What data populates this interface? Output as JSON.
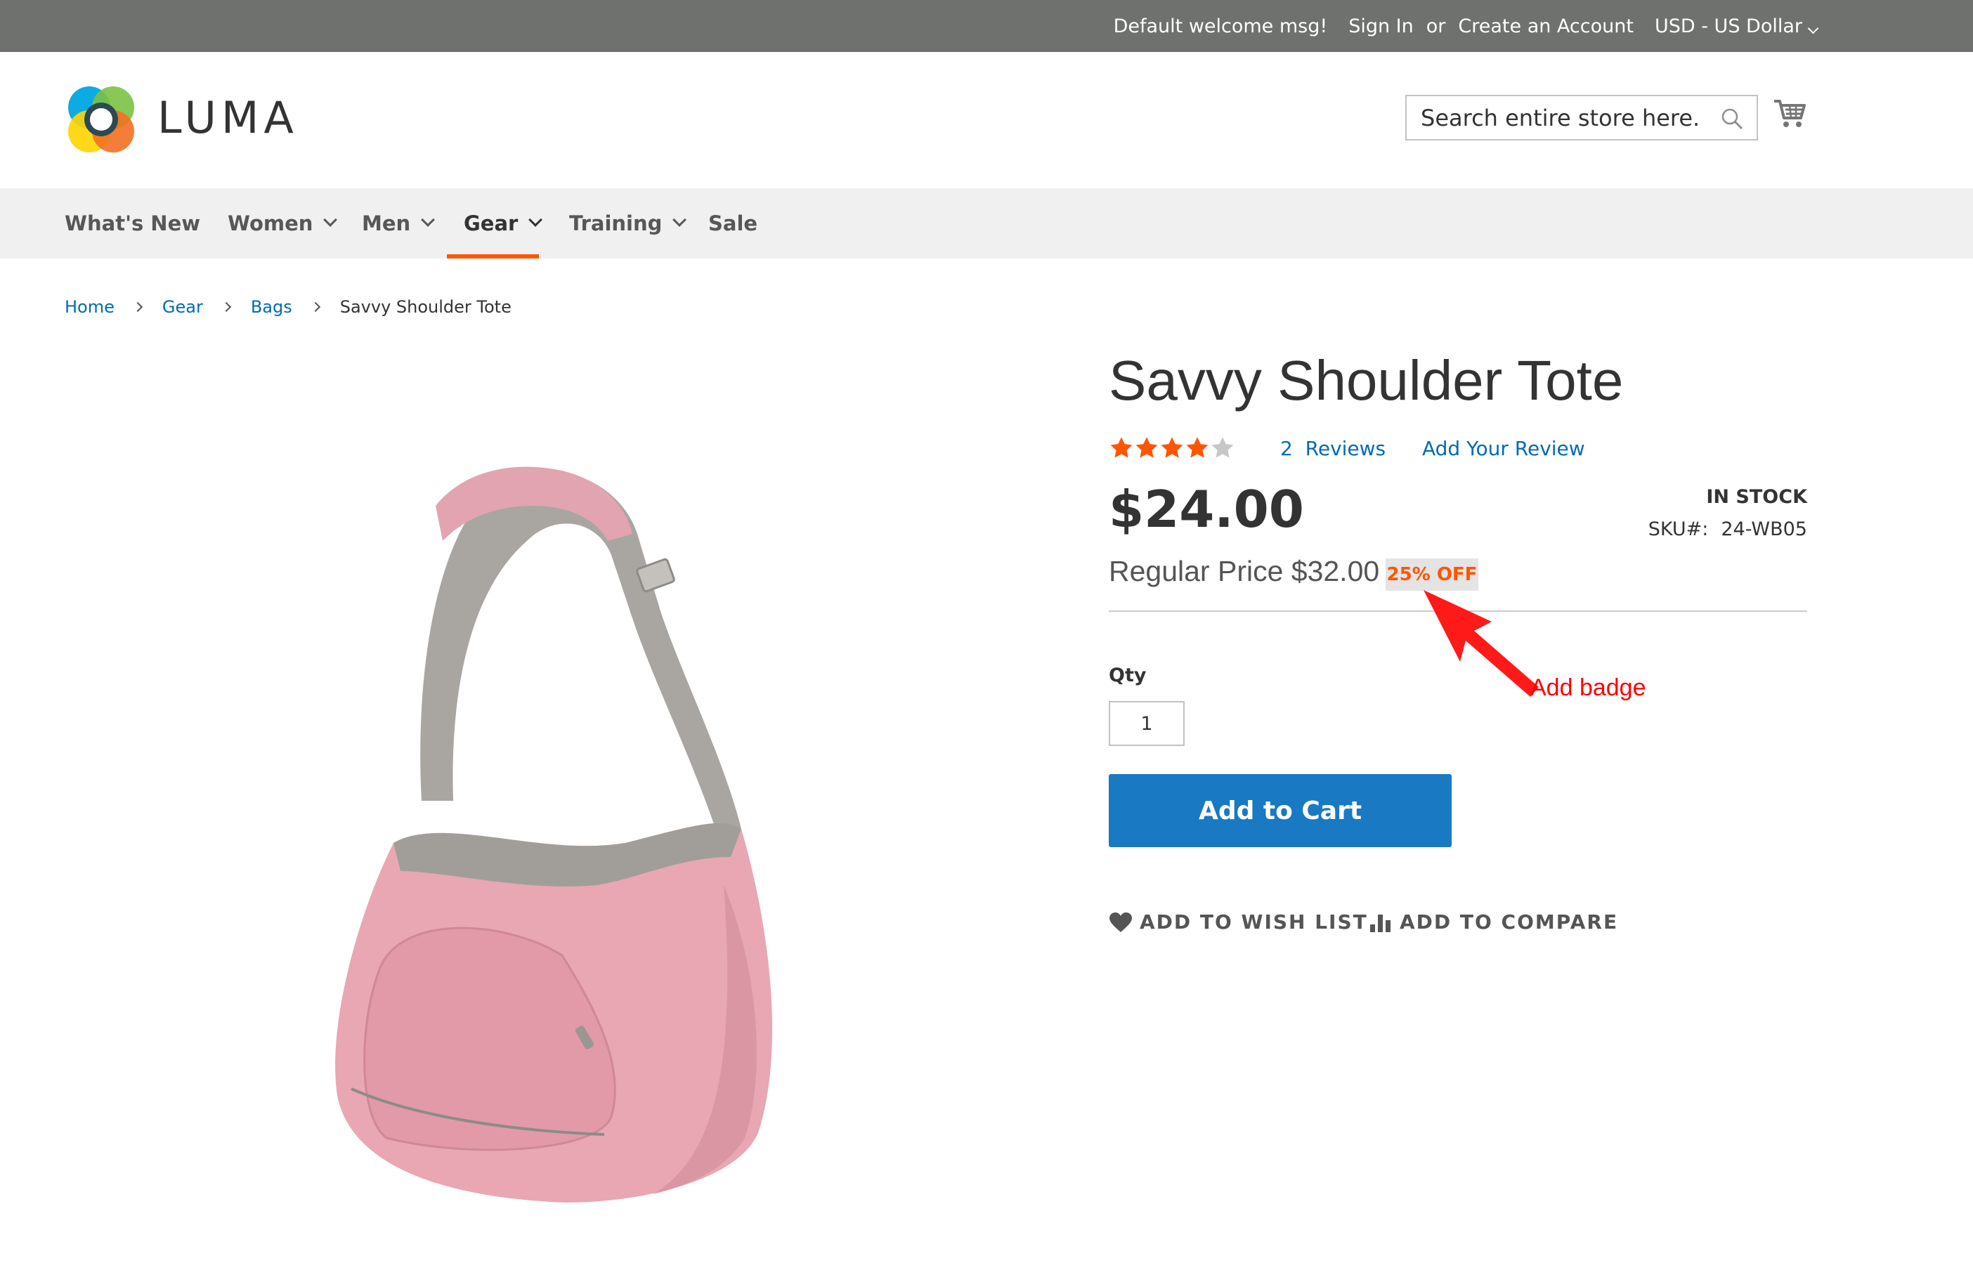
{
  "top_bar": {
    "welcome": "Default welcome msg!",
    "sign_in": "Sign In",
    "or": "or",
    "create_account": "Create an Account",
    "currency": "USD - US Dollar"
  },
  "header": {
    "logo_text": "LUMA",
    "search_placeholder": "Search entire store here...",
    "icons": [
      "luma-logo-icon",
      "search-icon",
      "cart-icon"
    ]
  },
  "nav": {
    "items": [
      {
        "label": "What's New",
        "has_dropdown": false
      },
      {
        "label": "Women",
        "has_dropdown": true
      },
      {
        "label": "Men",
        "has_dropdown": true
      },
      {
        "label": "Gear",
        "has_dropdown": true,
        "active": true
      },
      {
        "label": "Training",
        "has_dropdown": true
      },
      {
        "label": "Sale",
        "has_dropdown": false
      }
    ],
    "active_color": "#ff5501"
  },
  "breadcrumb": {
    "items": [
      "Home",
      "Gear",
      "Bags"
    ],
    "current": "Savvy Shoulder Tote"
  },
  "product": {
    "title": "Savvy Shoulder Tote",
    "rating": 4,
    "rating_max": 5,
    "reviews_count": "2",
    "reviews_label": "Reviews",
    "add_review": "Add Your Review",
    "price": "$24.00",
    "stock": "IN STOCK",
    "sku_label": "SKU#:",
    "sku": "24-WB05",
    "regular_price": "Regular Price $32.00",
    "discount_badge": "25% OFF",
    "qty_label": "Qty",
    "qty_value": "1",
    "add_to_cart": "Add to Cart",
    "wish_list": "ADD TO WISH LIST",
    "compare": "ADD TO COMPARE",
    "image_color": "#e8a7b3"
  },
  "annotation": {
    "text": "Add badge",
    "color": "#ff0000"
  },
  "colors": {
    "top_bar": "#6e716e",
    "link": "#006bb4",
    "button": "#1979c3",
    "star": "#ff5501"
  }
}
